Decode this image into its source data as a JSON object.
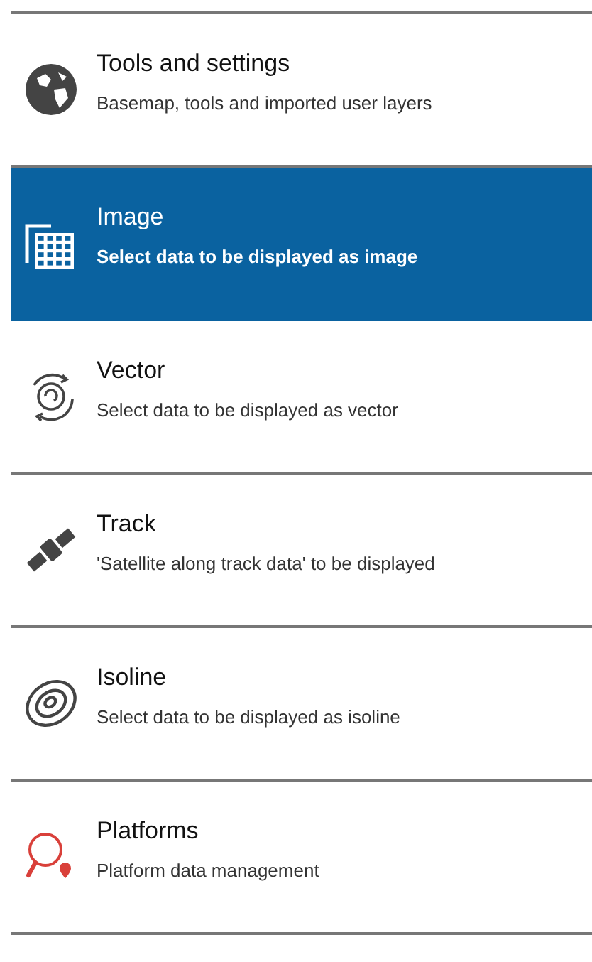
{
  "items": [
    {
      "kind": "globe",
      "title": "Tools and settings",
      "subtitle": "Basemap, tools and imported user layers",
      "selected": false
    },
    {
      "kind": "grid",
      "title": "Image",
      "subtitle": "Select data to be displayed as image",
      "selected": true
    },
    {
      "kind": "vector",
      "title": "Vector",
      "subtitle": "Select data to be displayed as vector",
      "selected": false
    },
    {
      "kind": "satellite",
      "title": "Track",
      "subtitle": "'Satellite along track data' to be displayed",
      "selected": false
    },
    {
      "kind": "isoline",
      "title": "Isoline",
      "subtitle": "Select data to be displayed as isoline",
      "selected": false
    },
    {
      "kind": "platform",
      "title": "Platforms",
      "subtitle": "Platform data management",
      "selected": false
    }
  ]
}
